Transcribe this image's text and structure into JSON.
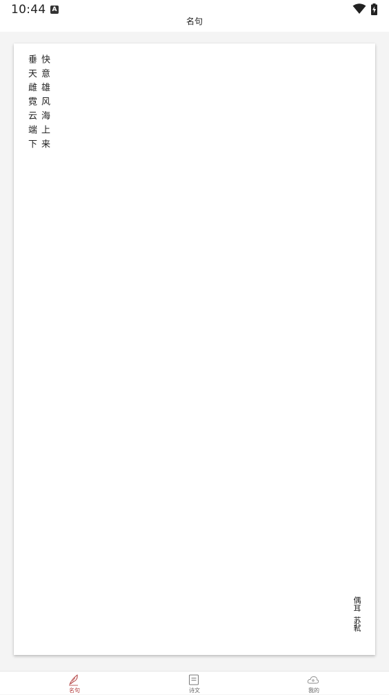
{
  "status_bar": {
    "time": "10:44",
    "notification_icon_letter": "A"
  },
  "header": {
    "title": "名句"
  },
  "quote": {
    "lines": [
      "快意雄风海上来",
      "垂天雌霓云端下"
    ],
    "source_title": "偶耳",
    "source_author": "苏轼"
  },
  "tab_bar": {
    "active_color": "#b03a3a",
    "tabs": [
      {
        "label": "名句",
        "icon": "quill-icon",
        "active": true
      },
      {
        "label": "诗文",
        "icon": "book-icon",
        "active": false
      },
      {
        "label": "我的",
        "icon": "cloud-user-icon",
        "active": false
      }
    ]
  }
}
